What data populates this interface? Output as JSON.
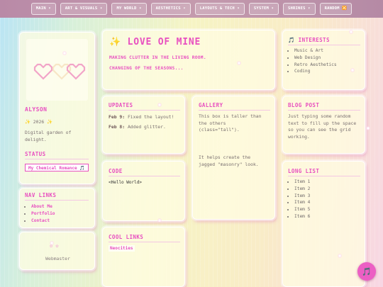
{
  "nav": [
    {
      "label": "MAIN ▾"
    },
    {
      "label": "ART & VISUALS ▾"
    },
    {
      "label": "MY WORLD ▾"
    },
    {
      "label": "AESTHETICS ▾"
    },
    {
      "label": "LAYOUTS & TECH ▾"
    },
    {
      "label": "SYSTEM ▾"
    },
    {
      "label": "SHRINES ▾"
    },
    {
      "label": "RANDOM 🔀"
    }
  ],
  "profile": {
    "name": "ALYSON",
    "year": "✨ 2026 ✨",
    "description": "Digital garden of delight."
  },
  "status": {
    "heading": "STATUS",
    "song": "My Chemical Romance 🎵"
  },
  "navlinks": {
    "heading": "NAV LINKS",
    "items": [
      "About Me",
      "Portfolio",
      "Contact"
    ]
  },
  "webmaster": {
    "label": "Webmaster"
  },
  "hero": {
    "title": "✨ LOVE OF MINE",
    "line1": "MAKING CLUTTER IN THE LIVING ROOM.",
    "line2": "CHANGING OF THE SEASONS..."
  },
  "interests": {
    "heading": "🎵 INTERESTS",
    "items": [
      "Music & Art",
      "Web Design",
      "Retro Aesthetics",
      "Coding"
    ]
  },
  "updates": {
    "heading": "UPDATES",
    "entries": [
      {
        "date": "Feb 9:",
        "text": "Fixed the layout!"
      },
      {
        "date": "Feb 8:",
        "text": "Added glitter."
      }
    ]
  },
  "gallery": {
    "heading": "GALLERY",
    "p1": "This box is taller than the others (class=\"tall\").",
    "p2": "It helps create the jagged \"masonry\" look."
  },
  "blog": {
    "heading": "BLOG POST",
    "text": "Just typing some random text to fill up the space so you can see the grid working."
  },
  "code": {
    "heading": "CODE",
    "snippet": "<Hello World>"
  },
  "longlist": {
    "heading": "LONG LIST",
    "items": [
      "Item 1",
      "Item 2",
      "Item 3",
      "Item 4",
      "Item 5",
      "Item 6"
    ]
  },
  "coollinks": {
    "heading": "COOL LINKS",
    "items": [
      "Neocities"
    ]
  },
  "music_button": {
    "icon": "🎵"
  }
}
